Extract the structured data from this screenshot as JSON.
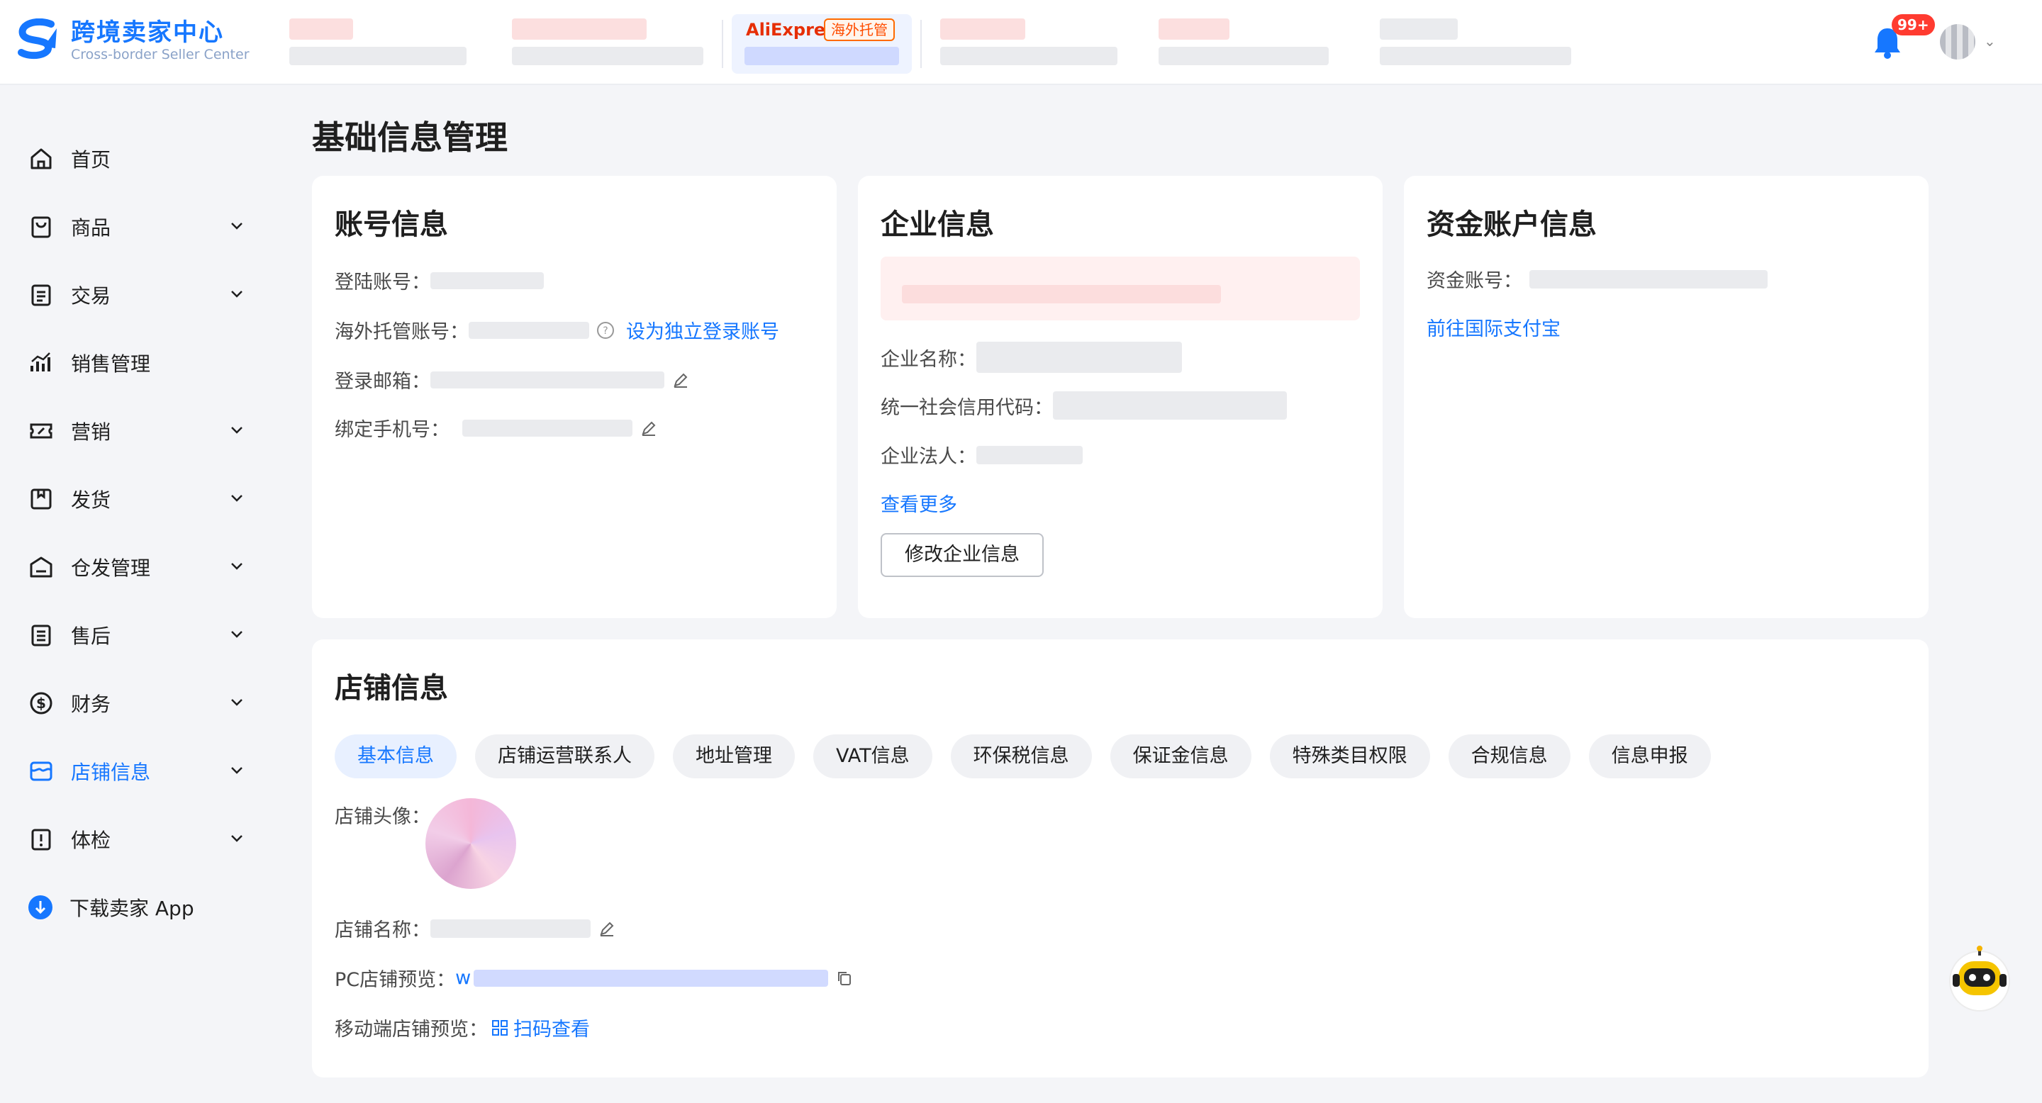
{
  "colors": {
    "accent": "#1677ff",
    "badge": "#ff3b30",
    "ae": "#e62e04"
  },
  "brand": {
    "title": "跨境卖家中心",
    "subtitle": "Cross-border Seller Center"
  },
  "header": {
    "active_store": {
      "brand": "AliExpress",
      "badge": "海外托管"
    },
    "notifications": "99+"
  },
  "sidebar": {
    "items": [
      {
        "label": "首页",
        "icon": "home-icon"
      },
      {
        "label": "商品",
        "icon": "product-bag-icon"
      },
      {
        "label": "交易",
        "icon": "clipboard-icon"
      },
      {
        "label": "销售管理",
        "icon": "sales-chart-icon"
      },
      {
        "label": "营销",
        "icon": "ticket-icon"
      },
      {
        "label": "发货",
        "icon": "package-icon"
      },
      {
        "label": "仓发管理",
        "icon": "warehouse-icon"
      },
      {
        "label": "售后",
        "icon": "after-sales-icon"
      },
      {
        "label": "财务",
        "icon": "dollar-icon"
      },
      {
        "label": "店铺信息",
        "icon": "store-icon"
      },
      {
        "label": "体检",
        "icon": "checkup-icon"
      }
    ],
    "download": "下载卖家 App"
  },
  "page": {
    "title": "基础信息管理"
  },
  "account": {
    "title": "账号信息",
    "login_label": "登陆账号：",
    "overseas_label": "海外托管账号：",
    "set_independent": "设为独立登录账号",
    "email_label": "登录邮箱：",
    "phone_label": "绑定手机号："
  },
  "enterprise": {
    "title": "企业信息",
    "name_label": "企业名称：",
    "credit_label": "统一社会信用代码：",
    "legal_label": "企业法人：",
    "view_more": "查看更多",
    "edit_button": "修改企业信息"
  },
  "funds": {
    "title": "资金账户信息",
    "account_label": "资金账号：",
    "goto_alipay": "前往国际支付宝"
  },
  "store": {
    "title": "店铺信息",
    "tabs": [
      "基本信息",
      "店铺运营联系人",
      "地址管理",
      "VAT信息",
      "环保税信息",
      "保证金信息",
      "特殊类目权限",
      "合规信息",
      "信息申报"
    ],
    "avatar_label": "店铺头像：",
    "name_label": "店铺名称：",
    "pc_preview_label": "PC店铺预览：",
    "pc_preview_value": "w",
    "mobile_preview_label": "移动端店铺预览：",
    "scan_qr": "扫码查看"
  }
}
